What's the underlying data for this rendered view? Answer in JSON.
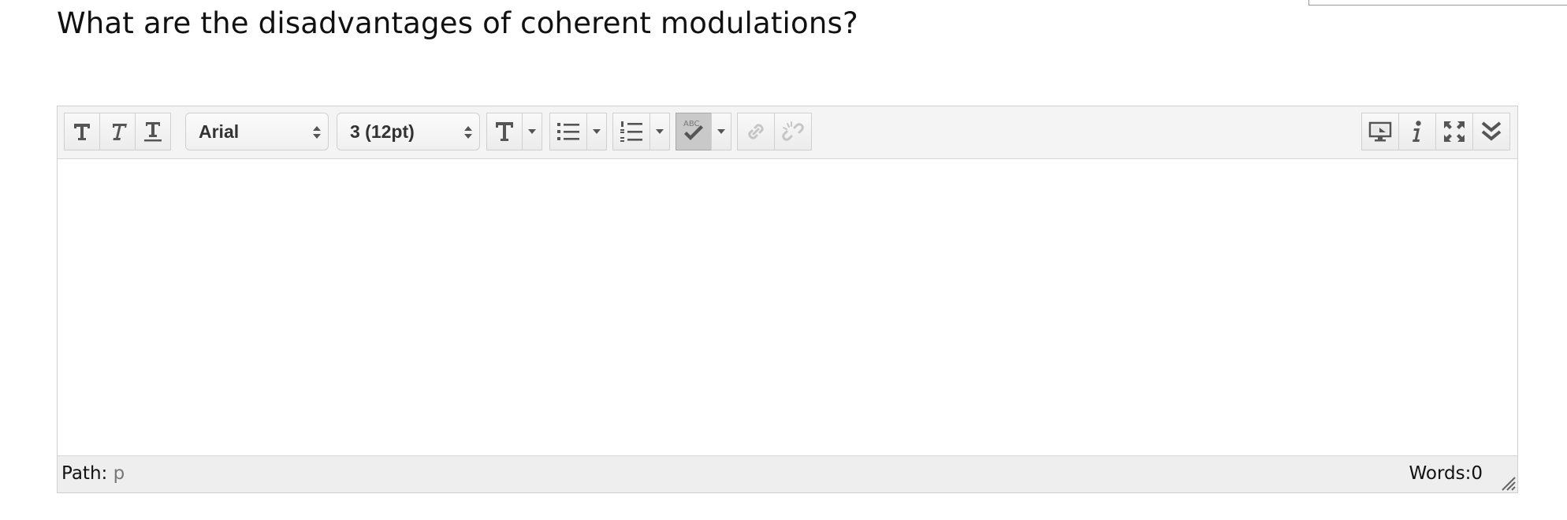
{
  "question": {
    "title": "What are the disadvantages of coherent modulations?"
  },
  "editor": {
    "toolbar": {
      "format_buttons": [
        "bold-icon",
        "italic-icon",
        "underline-icon"
      ],
      "font_family": {
        "selected": "Arial"
      },
      "font_size": {
        "selected": "3 (12pt)"
      },
      "text_color_icon": "text-color-icon",
      "bullet_list_icon": "bullet-list-icon",
      "numbered_list_icon": "numbered-list-icon",
      "spellcheck_icon": "spellcheck-icon",
      "spellcheck_label": "ABC",
      "link_icon": "link-icon",
      "unlink_icon": "unlink-icon",
      "right_icons": [
        "preview-icon",
        "info-icon",
        "fullscreen-icon",
        "collapse-toolbar-icon"
      ]
    },
    "content": "",
    "statusbar": {
      "path_label": "Path:",
      "path_value": "p",
      "word_count": "Words:0"
    }
  },
  "colors": {
    "toolbar_bg": "#f4f4f4",
    "statusbar_bg": "#eeeeee",
    "active_button_bg": "#c9c9c9",
    "icon_color": "#555555"
  }
}
